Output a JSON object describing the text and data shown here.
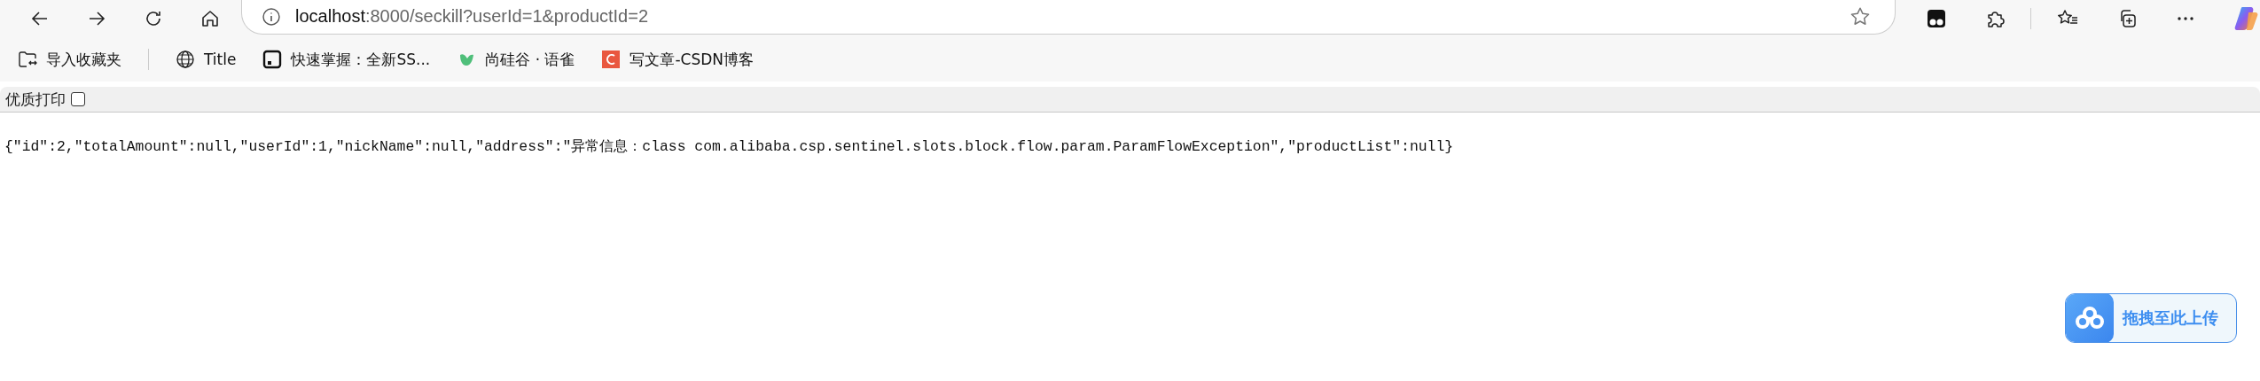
{
  "address_bar": {
    "host": "localhost",
    "path": ":8000/seckill?userId=1&productId=2"
  },
  "bookmarks": [
    {
      "label": "导入收藏夹",
      "kind": "folder"
    },
    {
      "label": "Title",
      "kind": "globe"
    },
    {
      "label": "快速掌握：全新SS...",
      "kind": "square"
    },
    {
      "label": "尚硅谷 · 语雀",
      "kind": "leaf"
    },
    {
      "label": "写文章-CSDN博客",
      "kind": "logo"
    }
  ],
  "print_bar": {
    "label": "优质打印",
    "checked": false
  },
  "body_text": "{\"id\":2,\"totalAmount\":null,\"userId\":1,\"nickName\":null,\"address\":\"异常信息：class com.alibaba.csp.sentinel.slots.block.flow.param.ParamFlowException\",\"productList\":null}",
  "upload_button": {
    "label": "拖拽至此上传"
  }
}
